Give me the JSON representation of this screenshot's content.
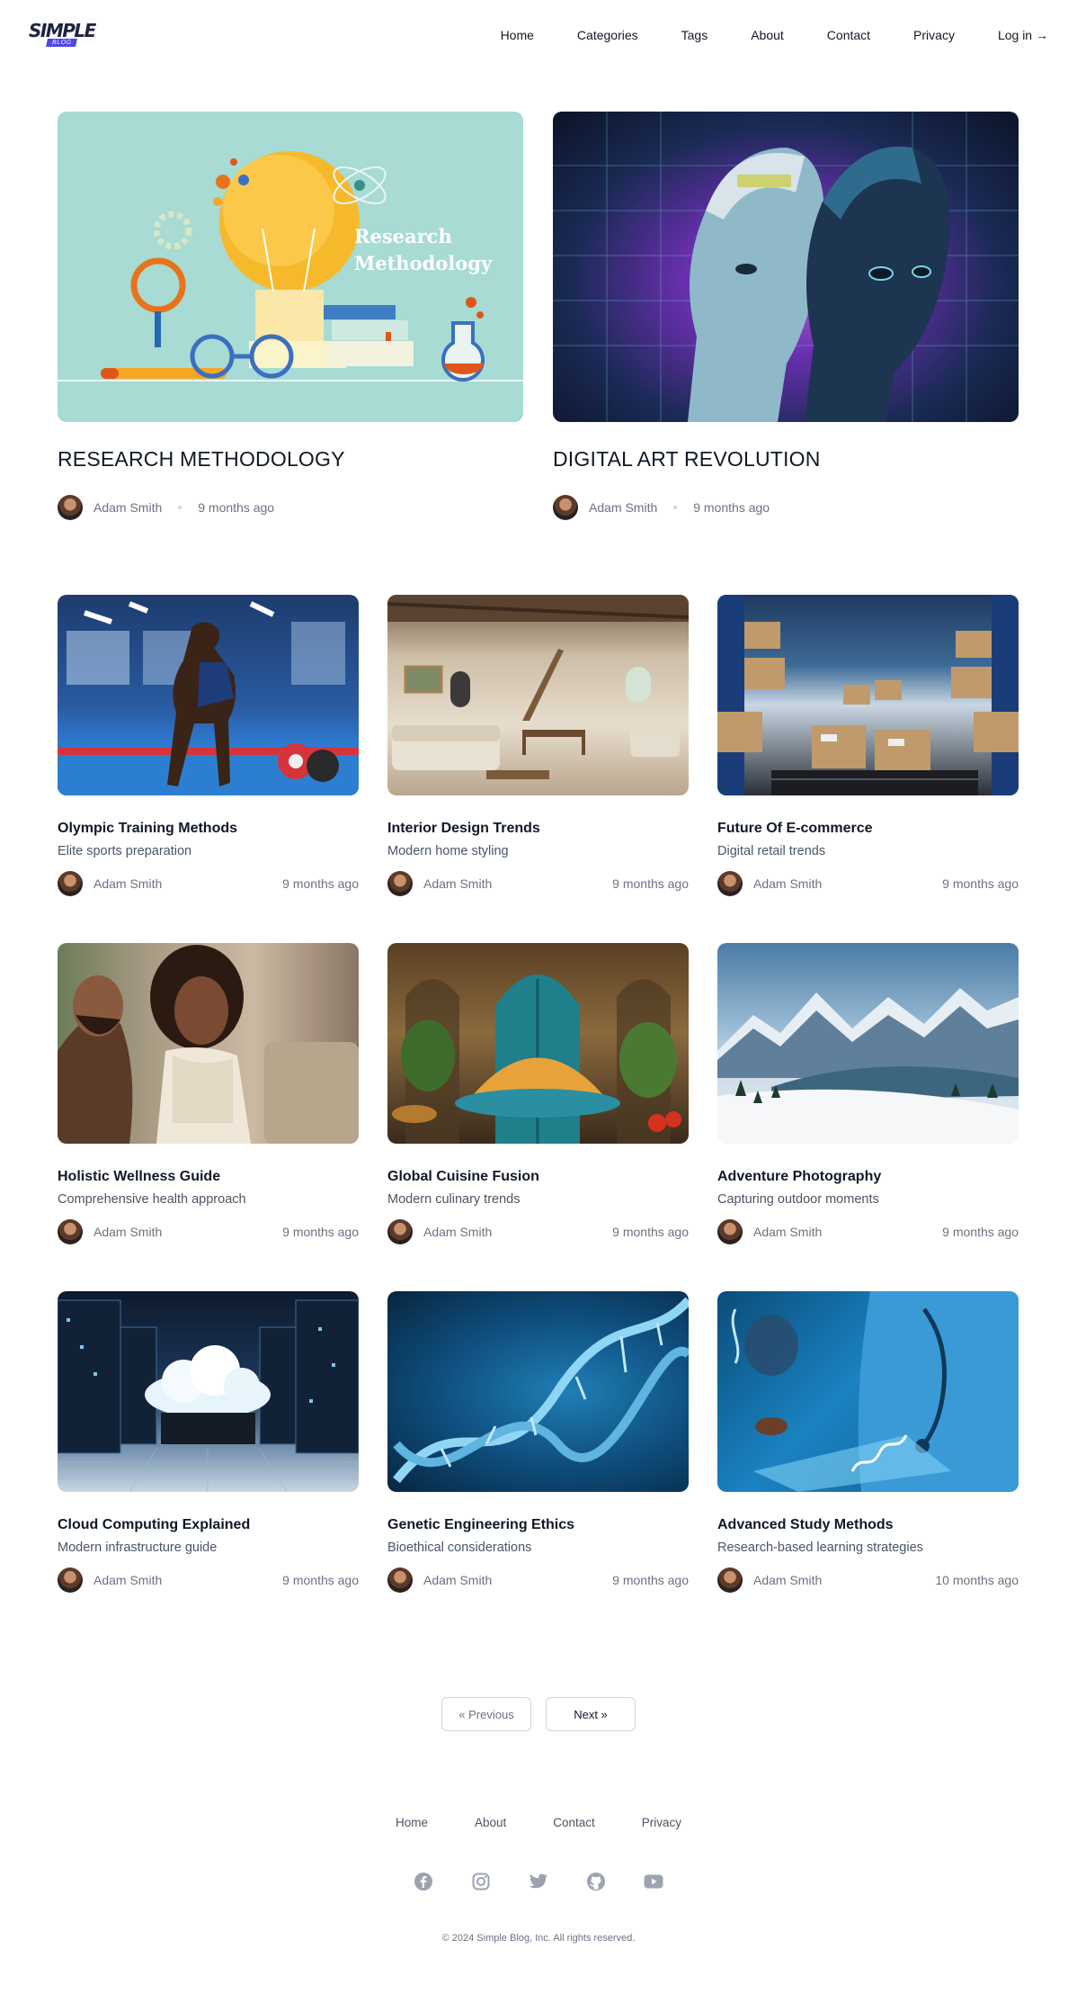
{
  "header": {
    "logo_text": "SIMPLE",
    "logo_tag": "BLOG",
    "nav": [
      "Home",
      "Categories",
      "Tags",
      "About",
      "Contact",
      "Privacy",
      "Log in →"
    ]
  },
  "featured": [
    {
      "title": "RESEARCH METHODOLOGY",
      "image_text": [
        "Research",
        "Methodology"
      ],
      "author": "Adam Smith",
      "time": "9 months ago"
    },
    {
      "title": "DIGITAL ART REVOLUTION",
      "author": "Adam Smith",
      "time": "9 months ago"
    }
  ],
  "posts": [
    {
      "title": "Olympic Training Methods",
      "subtitle": "Elite sports preparation",
      "author": "Adam Smith",
      "time": "9 months ago"
    },
    {
      "title": "Interior Design Trends",
      "subtitle": "Modern home styling",
      "author": "Adam Smith",
      "time": "9 months ago"
    },
    {
      "title": "Future Of E-commerce",
      "subtitle": "Digital retail trends",
      "author": "Adam Smith",
      "time": "9 months ago"
    },
    {
      "title": "Holistic Wellness Guide",
      "subtitle": "Comprehensive health approach",
      "author": "Adam Smith",
      "time": "9 months ago"
    },
    {
      "title": "Global Cuisine Fusion",
      "subtitle": "Modern culinary trends",
      "author": "Adam Smith",
      "time": "9 months ago"
    },
    {
      "title": "Adventure Photography",
      "subtitle": "Capturing outdoor moments",
      "author": "Adam Smith",
      "time": "9 months ago"
    },
    {
      "title": "Cloud Computing Explained",
      "subtitle": "Modern infrastructure guide",
      "author": "Adam Smith",
      "time": "9 months ago"
    },
    {
      "title": "Genetic Engineering Ethics",
      "subtitle": "Bioethical considerations",
      "author": "Adam Smith",
      "time": "9 months ago"
    },
    {
      "title": "Advanced Study Methods",
      "subtitle": "Research-based learning strategies",
      "author": "Adam Smith",
      "time": "10 months ago"
    }
  ],
  "pagination": {
    "prev": "« Previous",
    "next": "Next »"
  },
  "footer": {
    "nav": [
      "Home",
      "About",
      "Contact",
      "Privacy"
    ],
    "socials": [
      "facebook-icon",
      "instagram-icon",
      "twitter-icon",
      "github-icon",
      "youtube-icon"
    ],
    "copyright": "© 2024 Simple Blog, Inc. All rights reserved."
  }
}
